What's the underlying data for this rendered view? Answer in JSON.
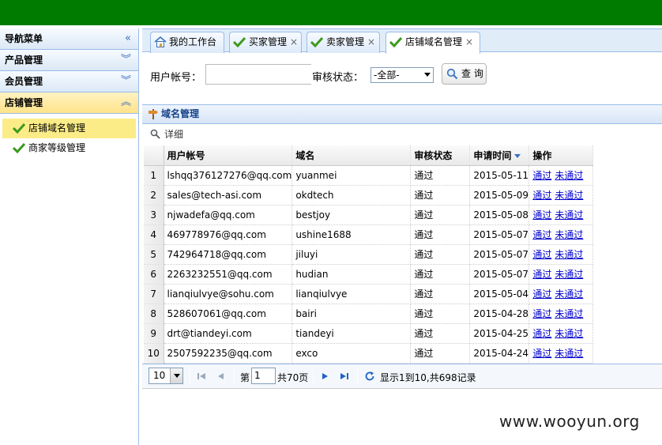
{
  "sidebar": {
    "title": "导航菜单",
    "groups": [
      {
        "label": "产品管理"
      },
      {
        "label": "会员管理"
      },
      {
        "label": "店铺管理"
      }
    ],
    "items": [
      {
        "label": "店铺域名管理"
      },
      {
        "label": "商家等级管理"
      }
    ]
  },
  "tabs": [
    {
      "label": "我的工作台"
    },
    {
      "label": "买家管理"
    },
    {
      "label": "卖家管理"
    },
    {
      "label": "店铺域名管理"
    }
  ],
  "form": {
    "account_label": "用户帐号：",
    "account_value": "",
    "status_label": "审核状态：",
    "status_value": "-全部-",
    "query_button": "查 询"
  },
  "panel": {
    "title": "域名管理",
    "detail_button": "详细"
  },
  "grid": {
    "columns": [
      "用户帐号",
      "域名",
      "审核状态",
      "申请时间",
      "操作"
    ],
    "rows": [
      {
        "n": "1",
        "account": "lshqq376127276@qq.com",
        "domain": "yuanmei",
        "status": "通过",
        "date": "2015-05-11"
      },
      {
        "n": "2",
        "account": "sales@tech-asi.com",
        "domain": "okdtech",
        "status": "通过",
        "date": "2015-05-09"
      },
      {
        "n": "3",
        "account": "njwadefa@qq.com",
        "domain": "bestjoy",
        "status": "通过",
        "date": "2015-05-08"
      },
      {
        "n": "4",
        "account": "469778976@qq.com",
        "domain": "ushine1688",
        "status": "通过",
        "date": "2015-05-07"
      },
      {
        "n": "5",
        "account": "742964718@qq.com",
        "domain": "jiluyi",
        "status": "通过",
        "date": "2015-05-07"
      },
      {
        "n": "6",
        "account": "2263232551@qq.com",
        "domain": "hudian",
        "status": "通过",
        "date": "2015-05-07"
      },
      {
        "n": "7",
        "account": "lianqiulvye@sohu.com",
        "domain": "lianqiulvye",
        "status": "通过",
        "date": "2015-05-04"
      },
      {
        "n": "8",
        "account": "528607061@qq.com",
        "domain": "bairi",
        "status": "通过",
        "date": "2015-04-28"
      },
      {
        "n": "9",
        "account": "drt@tiandeyi.com",
        "domain": "tiandeyi",
        "status": "通过",
        "date": "2015-04-25"
      },
      {
        "n": "10",
        "account": "2507592235@qq.com",
        "domain": "exco",
        "status": "通过",
        "date": "2015-04-24"
      }
    ],
    "action_pass": "通过",
    "action_reject": "未通过"
  },
  "pager": {
    "page_size": "10",
    "page_prefix": "第",
    "page_value": "1",
    "page_total": "共70页",
    "summary": "显示1到10,共698记录"
  },
  "watermark": "www.wooyun.org",
  "colors": {
    "topbar": "#007b00",
    "link": "#0000cc",
    "header_text": "#15428b"
  }
}
